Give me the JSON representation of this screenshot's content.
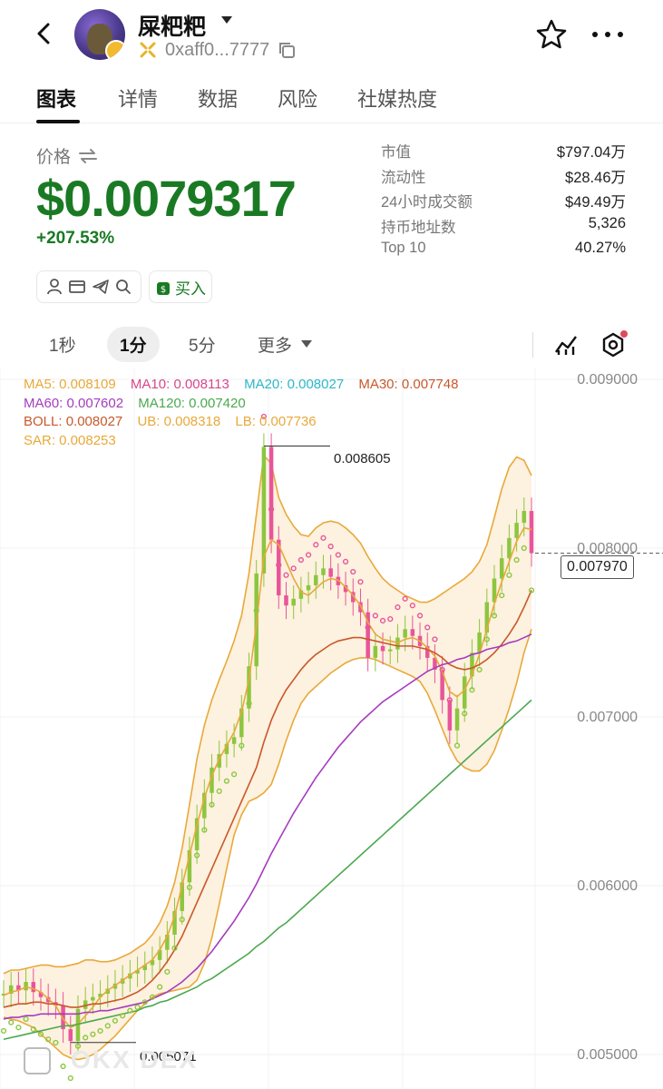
{
  "header": {
    "token_name": "屎粑粑",
    "address": "0xaff0...7777",
    "icons": [
      "back-arrow-icon",
      "chevron-down-icon",
      "copy-icon",
      "star-icon",
      "more-icon"
    ]
  },
  "tabs": [
    {
      "label": "图表",
      "active": true
    },
    {
      "label": "详情",
      "active": false
    },
    {
      "label": "数据",
      "active": false
    },
    {
      "label": "风险",
      "active": false
    },
    {
      "label": "社媒热度",
      "active": false
    }
  ],
  "price": {
    "label": "价格",
    "value": "$0.0079317",
    "change": "+207.53%",
    "color": "#1a7a24"
  },
  "actions": {
    "buy_label": "买入",
    "icons": [
      "user-icon",
      "browser-icon",
      "telegram-icon",
      "search-icon",
      "money-bag-icon"
    ]
  },
  "stats": [
    {
      "key": "市值",
      "value": "$797.04万"
    },
    {
      "key": "流动性",
      "value": "$28.46万"
    },
    {
      "key": "24小时成交额",
      "value": "$49.49万"
    },
    {
      "key": "持币地址数",
      "value": "5,326"
    },
    {
      "key": "Top 10",
      "value": "40.27%"
    }
  ],
  "intervals": [
    {
      "label": "1秒",
      "active": false
    },
    {
      "label": "1分",
      "active": true
    },
    {
      "label": "5分",
      "active": false
    },
    {
      "label": "更多",
      "active": false
    }
  ],
  "chart_tools": [
    "indicator-icon",
    "settings-hex-icon"
  ],
  "chart_data": {
    "type": "line",
    "legend": [
      {
        "text": "MA5: 0.008109",
        "color": "#e8a93a"
      },
      {
        "text": "MA10: 0.008113",
        "color": "#d9468a"
      },
      {
        "text": "MA20: 0.008027",
        "color": "#2bb8c9"
      },
      {
        "text": "MA30: 0.007748",
        "color": "#c9582a"
      },
      {
        "text": "MA60: 0.007602",
        "color": "#a63bbf"
      },
      {
        "text": "MA120: 0.007420",
        "color": "#4aa84e"
      },
      {
        "text": "BOLL: 0.008027",
        "color": "#c9582a"
      },
      {
        "text": "UB: 0.008318",
        "color": "#e8a93a"
      },
      {
        "text": "LB: 0.007736",
        "color": "#e8a93a"
      },
      {
        "text": "SAR: 0.008253",
        "color": "#e8a93a"
      }
    ],
    "y_ticks": [
      "0.009000",
      "0.008000",
      "0.007000",
      "0.006000",
      "0.005000"
    ],
    "ylim": [
      0.005,
      0.009
    ],
    "current_price": "0.007970",
    "high_label": "0.008605",
    "low_label": "0.005071",
    "high": 0.008605,
    "low": 0.005071,
    "close_series": [
      0.00536,
      0.00541,
      0.00538,
      0.00543,
      0.00537,
      0.00534,
      0.00531,
      0.00529,
      0.00515,
      0.00508,
      0.00527,
      0.00532,
      0.00534,
      0.00536,
      0.00539,
      0.00542,
      0.00545,
      0.00548,
      0.0055,
      0.00553,
      0.00556,
      0.00562,
      0.00571,
      0.00585,
      0.00602,
      0.00621,
      0.0064,
      0.00655,
      0.0067,
      0.00678,
      0.00684,
      0.00688,
      0.00705,
      0.0073,
      0.00785,
      0.0086,
      0.00805,
      0.00772,
      0.00766,
      0.0077,
      0.00775,
      0.00778,
      0.00784,
      0.00788,
      0.00783,
      0.00778,
      0.00774,
      0.00768,
      0.00762,
      0.00735,
      0.00742,
      0.00739,
      0.0074,
      0.00747,
      0.00752,
      0.00748,
      0.00742,
      0.00735,
      0.00728,
      0.0071,
      0.00692,
      0.00705,
      0.00724,
      0.00738,
      0.0075,
      0.00768,
      0.00782,
      0.00794,
      0.00806,
      0.00815,
      0.00822,
      0.00797
    ],
    "ma_series": [
      {
        "name": "MA5",
        "color": "#e8a93a",
        "values": [
          0.00535,
          0.00537,
          0.00538,
          0.0054,
          0.00539,
          0.00537,
          0.00533,
          0.00529,
          0.00521,
          0.00516,
          0.00518,
          0.00523,
          0.00528,
          0.00534,
          0.00538,
          0.00541,
          0.00544,
          0.00547,
          0.0055,
          0.00553,
          0.00556,
          0.00562,
          0.0057,
          0.00582,
          0.006,
          0.00618,
          0.00636,
          0.00652,
          0.00665,
          0.00675,
          0.00683,
          0.00691,
          0.00703,
          0.00722,
          0.00755,
          0.00795,
          0.00805,
          0.00802,
          0.00792,
          0.00782,
          0.00774,
          0.00772,
          0.00776,
          0.0078,
          0.00782,
          0.00781,
          0.00777,
          0.00772,
          0.00766,
          0.00756,
          0.00749,
          0.00746,
          0.00745,
          0.00744,
          0.00746,
          0.00747,
          0.00745,
          0.00741,
          0.00736,
          0.00727,
          0.00715,
          0.00712,
          0.00716,
          0.00725,
          0.00737,
          0.00752,
          0.00767,
          0.0078,
          0.00792,
          0.00804,
          0.00812,
          0.00811
        ]
      },
      {
        "name": "MA30",
        "color": "#c9582a",
        "values": [
          0.00528,
          0.00529,
          0.0053,
          0.0053,
          0.00531,
          0.00531,
          0.0053,
          0.0053,
          0.00529,
          0.00528,
          0.00528,
          0.00529,
          0.0053,
          0.0053,
          0.00531,
          0.00532,
          0.00533,
          0.00535,
          0.00537,
          0.0054,
          0.00544,
          0.00549,
          0.00555,
          0.00562,
          0.0057,
          0.0058,
          0.0059,
          0.006,
          0.0061,
          0.0062,
          0.0063,
          0.0064,
          0.0065,
          0.0066,
          0.0067,
          0.00685,
          0.00698,
          0.00708,
          0.00716,
          0.00722,
          0.00728,
          0.00733,
          0.00737,
          0.0074,
          0.00743,
          0.00745,
          0.00746,
          0.00747,
          0.00747,
          0.00746,
          0.00745,
          0.00744,
          0.00743,
          0.00742,
          0.00742,
          0.00742,
          0.00741,
          0.0074,
          0.00738,
          0.00735,
          0.00731,
          0.00729,
          0.00728,
          0.00729,
          0.00731,
          0.00734,
          0.00738,
          0.00743,
          0.00749,
          0.00756,
          0.00765,
          0.00775
        ]
      },
      {
        "name": "MA60",
        "color": "#a63bbf",
        "values": [
          0.00521,
          0.00522,
          0.00522,
          0.00523,
          0.00523,
          0.00524,
          0.00524,
          0.00524,
          0.00524,
          0.00524,
          0.00524,
          0.00525,
          0.00525,
          0.00526,
          0.00526,
          0.00527,
          0.00528,
          0.00529,
          0.0053,
          0.00531,
          0.00533,
          0.00535,
          0.00537,
          0.0054,
          0.00543,
          0.00547,
          0.00551,
          0.00556,
          0.00561,
          0.00567,
          0.00573,
          0.00579,
          0.00586,
          0.00593,
          0.00601,
          0.0061,
          0.00619,
          0.00627,
          0.00635,
          0.00643,
          0.0065,
          0.00657,
          0.00664,
          0.0067,
          0.00676,
          0.00682,
          0.00687,
          0.00692,
          0.00697,
          0.00701,
          0.00705,
          0.00709,
          0.00712,
          0.00715,
          0.00718,
          0.00721,
          0.00724,
          0.00727,
          0.00729,
          0.00731,
          0.00732,
          0.00734,
          0.00735,
          0.00737,
          0.00738,
          0.0074,
          0.00741,
          0.00742,
          0.00744,
          0.00745,
          0.00747,
          0.00749
        ]
      },
      {
        "name": "MA120",
        "color": "#4aa84e",
        "values": [
          0.00509,
          0.0051,
          0.00511,
          0.00512,
          0.00513,
          0.00514,
          0.00515,
          0.00516,
          0.00517,
          0.00517,
          0.00518,
          0.00519,
          0.0052,
          0.00521,
          0.00522,
          0.00523,
          0.00524,
          0.00525,
          0.00526,
          0.00528,
          0.00529,
          0.00531,
          0.00532,
          0.00534,
          0.00536,
          0.00538,
          0.0054,
          0.00543,
          0.00545,
          0.00548,
          0.00551,
          0.00554,
          0.00557,
          0.0056,
          0.00564,
          0.00567,
          0.00571,
          0.00575,
          0.00578,
          0.00582,
          0.00586,
          0.0059,
          0.00594,
          0.00598,
          0.00602,
          0.00606,
          0.0061,
          0.00614,
          0.00618,
          0.00622,
          0.00626,
          0.0063,
          0.00634,
          0.00638,
          0.00642,
          0.00646,
          0.0065,
          0.00654,
          0.00658,
          0.00662,
          0.00666,
          0.0067,
          0.00674,
          0.00678,
          0.00682,
          0.00686,
          0.0069,
          0.00694,
          0.00698,
          0.00702,
          0.00706,
          0.0071
        ]
      }
    ],
    "boll_upper": [
      0.00548,
      0.0055,
      0.0055,
      0.00551,
      0.00552,
      0.00553,
      0.00553,
      0.00552,
      0.00552,
      0.00553,
      0.00554,
      0.00556,
      0.00556,
      0.00555,
      0.00555,
      0.00556,
      0.00558,
      0.0056,
      0.00563,
      0.00566,
      0.00571,
      0.00578,
      0.00588,
      0.00602,
      0.00622,
      0.00648,
      0.00675,
      0.00695,
      0.0071,
      0.00722,
      0.00733,
      0.00745,
      0.0076,
      0.00785,
      0.0082,
      0.00855,
      0.0085,
      0.0083,
      0.0082,
      0.00813,
      0.00808,
      0.00807,
      0.00812,
      0.00815,
      0.00816,
      0.00815,
      0.00812,
      0.00808,
      0.00803,
      0.00795,
      0.00788,
      0.00782,
      0.00778,
      0.00775,
      0.00772,
      0.0077,
      0.00768,
      0.00768,
      0.0077,
      0.00773,
      0.00776,
      0.00779,
      0.00782,
      0.00786,
      0.00792,
      0.00802,
      0.00818,
      0.00835,
      0.00848,
      0.00854,
      0.00852,
      0.00843
    ],
    "boll_lower": [
      0.00522,
      0.00521,
      0.0052,
      0.00518,
      0.00516,
      0.00512,
      0.00508,
      0.00504,
      0.005,
      0.00498,
      0.00497,
      0.00498,
      0.005,
      0.00503,
      0.00507,
      0.00511,
      0.00516,
      0.00521,
      0.00526,
      0.0053,
      0.00534,
      0.00536,
      0.00537,
      0.00538,
      0.00539,
      0.0054,
      0.00544,
      0.00554,
      0.00569,
      0.00589,
      0.0061,
      0.0063,
      0.00642,
      0.0065,
      0.00652,
      0.00655,
      0.0066,
      0.00672,
      0.00686,
      0.00698,
      0.00708,
      0.00714,
      0.00718,
      0.00722,
      0.00726,
      0.00729,
      0.00732,
      0.00734,
      0.00735,
      0.00735,
      0.00734,
      0.00732,
      0.0073,
      0.00728,
      0.00726,
      0.00724,
      0.00721,
      0.00714,
      0.00704,
      0.00693,
      0.00682,
      0.00674,
      0.0067,
      0.00668,
      0.00668,
      0.00672,
      0.0068,
      0.00692,
      0.00705,
      0.0072,
      0.00738,
      0.00752
    ]
  }
}
